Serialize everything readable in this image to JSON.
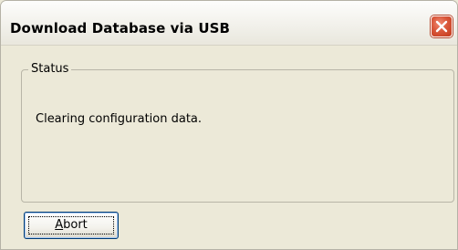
{
  "window": {
    "title": "Download Database via USB",
    "close_icon": "close-icon",
    "close_color": "#d9573a"
  },
  "status_group": {
    "legend": "Status",
    "message": "Clearing configuration data."
  },
  "buttons": {
    "abort": {
      "accel": "A",
      "rest": "bort"
    }
  }
}
